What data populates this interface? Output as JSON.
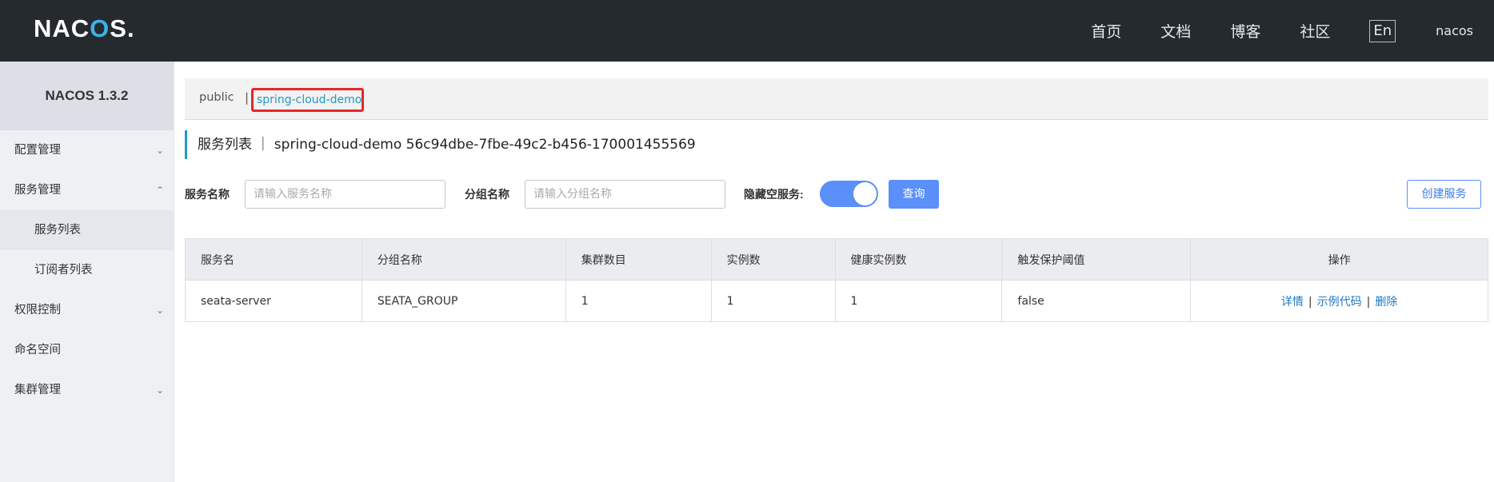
{
  "header": {
    "logo_text": "NACOS.",
    "nav": [
      "首页",
      "文档",
      "博客",
      "社区"
    ],
    "lang_button": "En",
    "user": "nacos"
  },
  "sidebar": {
    "title": "NACOS 1.3.2",
    "items": [
      {
        "label": "配置管理",
        "expandable": true,
        "expanded": false
      },
      {
        "label": "服务管理",
        "expandable": true,
        "expanded": true
      },
      {
        "label": "服务列表",
        "sub": true,
        "active": true
      },
      {
        "label": "订阅者列表",
        "sub": true
      },
      {
        "label": "权限控制",
        "expandable": true,
        "expanded": false
      },
      {
        "label": "命名空间"
      },
      {
        "label": "集群管理",
        "expandable": true,
        "expanded": false
      }
    ]
  },
  "namespace": {
    "public": "public",
    "separator": "|",
    "active": "spring-cloud-demo"
  },
  "page": {
    "title": "服务列表 ｜ spring-cloud-demo  56c94dbe-7fbe-49c2-b456-170001455569"
  },
  "search": {
    "service_name_label": "服务名称",
    "service_name_placeholder": "请输入服务名称",
    "group_name_label": "分组名称",
    "group_name_placeholder": "请输入分组名称",
    "hide_empty_label": "隐藏空服务:",
    "hide_empty_on": true,
    "query_button": "查询",
    "create_button": "创建服务"
  },
  "table": {
    "columns": [
      "服务名",
      "分组名称",
      "集群数目",
      "实例数",
      "健康实例数",
      "触发保护阈值",
      "操作"
    ],
    "rows": [
      {
        "service_name": "seata-server",
        "group_name": "SEATA_GROUP",
        "cluster_count": "1",
        "instance_count": "1",
        "healthy_instance_count": "1",
        "protect_threshold": "false",
        "actions": [
          "详情",
          "示例代码",
          "删除"
        ]
      }
    ]
  },
  "colors": {
    "header_bg": "#252a2f",
    "accent": "#5b8ff9",
    "link": "#1f78c2",
    "highlight_box": "#e62828",
    "namespace_active": "#209bc4"
  }
}
